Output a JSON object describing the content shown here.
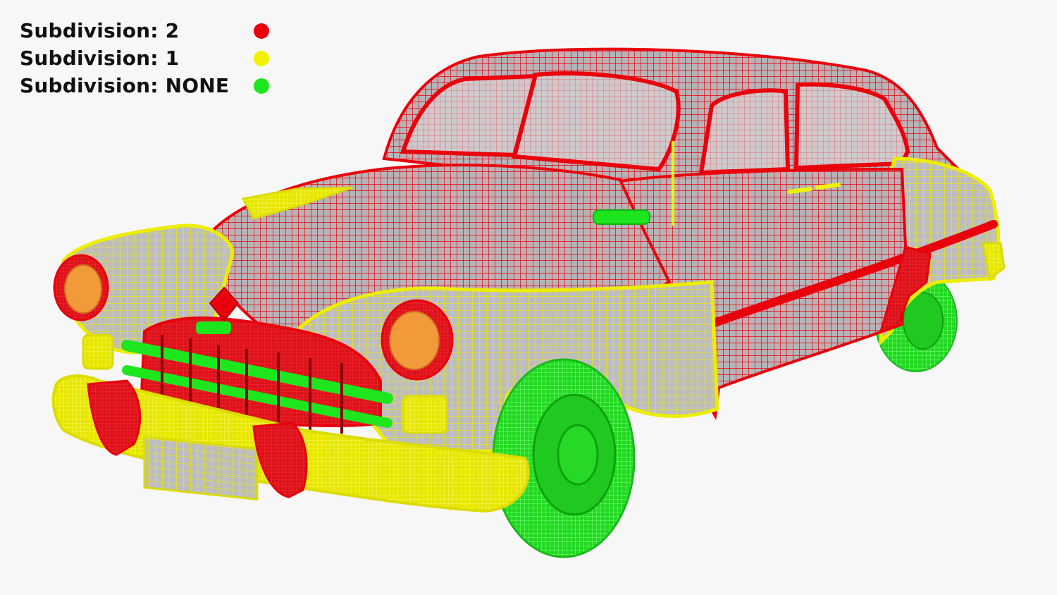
{
  "legend": {
    "items": [
      {
        "label": "Subdivision: 2",
        "color": "#e8000c"
      },
      {
        "label": "Subdivision: 1",
        "color": "#f2f200"
      },
      {
        "label": "Subdivision: NONE",
        "color": "#1ee61e"
      }
    ]
  },
  "colors": {
    "background": "#f7f7f7",
    "subdiv2": "#e8000c",
    "subdiv1": "#f2f200",
    "none": "#1ee61e",
    "glass": "#c9c4c8",
    "orange": "#f29a3a"
  }
}
